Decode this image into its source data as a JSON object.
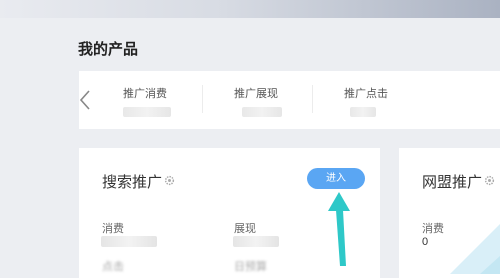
{
  "page": {
    "title": "我的产品"
  },
  "summary": {
    "stats": [
      {
        "label": "推广消费"
      },
      {
        "label": "推广展现"
      },
      {
        "label": "推广点击"
      }
    ]
  },
  "search_card": {
    "title": "搜索推广",
    "enter_label": "进入",
    "metrics": [
      {
        "label": "消费"
      },
      {
        "label": "展现"
      }
    ],
    "next_row": [
      {
        "label": "点击"
      },
      {
        "label": "日预算"
      }
    ]
  },
  "union_card": {
    "title": "网盟推广",
    "metrics": [
      {
        "label": "消费",
        "value": "0"
      }
    ]
  },
  "colors": {
    "accent": "#5aa6f3",
    "annotation_arrow": "#2ec8c8"
  },
  "icons": {
    "prev": "chevron-left-icon",
    "settings": "gear-icon"
  }
}
